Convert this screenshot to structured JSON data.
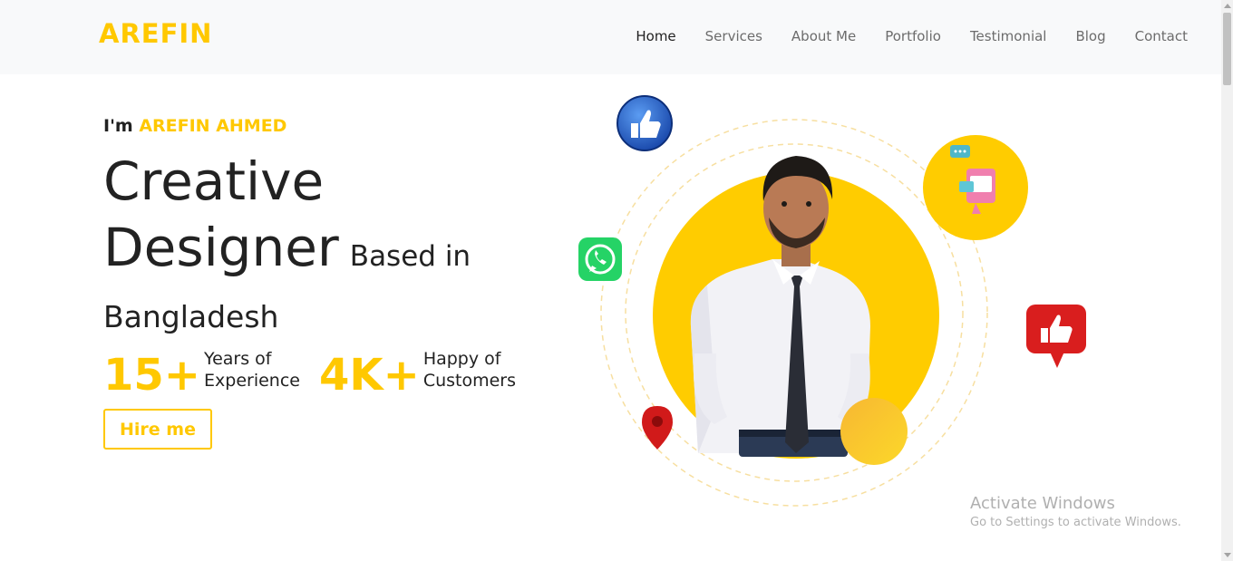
{
  "brand": "AREFIN",
  "nav": {
    "items": [
      "Home",
      "Services",
      "About Me",
      "Portfolio",
      "Testimonial",
      "Blog",
      "Contact"
    ]
  },
  "hero": {
    "intro_prefix": "I'm",
    "intro_name": "AREFIN AHMED",
    "headline_line1": "Creative",
    "headline_line2": "Designer",
    "headline_suffix": "Based in",
    "location": "Bangladesh",
    "stats": [
      {
        "value": "15+",
        "label_line1": "Years of",
        "label_line2": "Experience"
      },
      {
        "value": "4K+",
        "label_line1": "Happy of",
        "label_line2": "Customers"
      }
    ],
    "cta": "Hire me"
  },
  "colors": {
    "accent": "#ffc800",
    "text": "#222222",
    "nav_bg": "#f8f9fa"
  },
  "icons": [
    "thumbs-up-icon",
    "whatsapp-icon",
    "chat-icon",
    "thumbs-up-badge-icon",
    "location-pin-icon"
  ],
  "watermark": {
    "title": "Activate Windows",
    "subtitle": "Go to Settings to activate Windows."
  }
}
